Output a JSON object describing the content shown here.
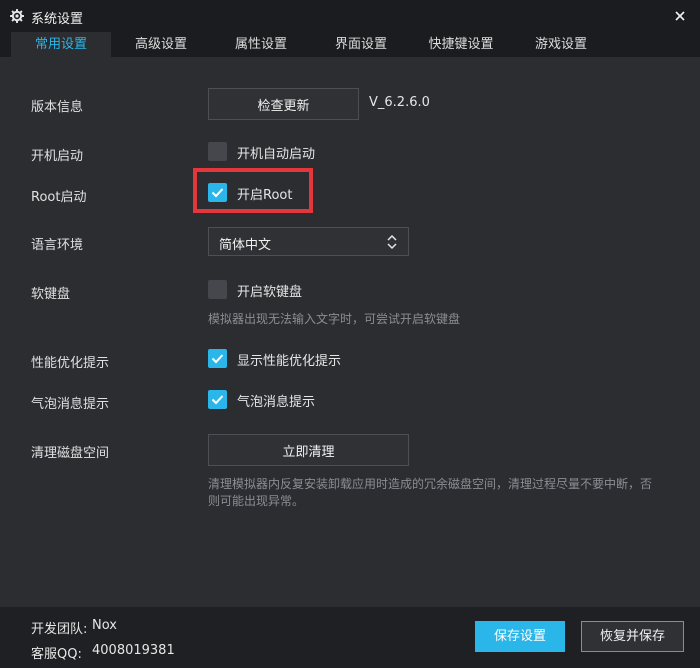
{
  "window": {
    "title": "系统设置",
    "icon": "gear-icon",
    "close_icon": "close-icon"
  },
  "tabs": [
    {
      "label": "常用设置",
      "active": true
    },
    {
      "label": "高级设置",
      "active": false
    },
    {
      "label": "属性设置",
      "active": false
    },
    {
      "label": "界面设置",
      "active": false
    },
    {
      "label": "快捷键设置",
      "active": false
    },
    {
      "label": "游戏设置",
      "active": false
    }
  ],
  "settings": {
    "version_info": {
      "label": "版本信息",
      "button": "检查更新",
      "version": "V_6.2.6.0"
    },
    "startup": {
      "label": "开机启动",
      "checkbox_label": "开机自动启动",
      "checked": false
    },
    "root": {
      "label": "Root启动",
      "checkbox_label": "开启Root",
      "checked": true
    },
    "language": {
      "label": "语言环境",
      "selected": "简体中文"
    },
    "soft_keyboard": {
      "label": "软键盘",
      "checkbox_label": "开启软键盘",
      "checked": false,
      "hint": "模拟器出现无法输入文字时，可尝试开启软键盘"
    },
    "performance_tip": {
      "label": "性能优化提示",
      "checkbox_label": "显示性能优化提示",
      "checked": true
    },
    "bubble_tip": {
      "label": "气泡消息提示",
      "checkbox_label": "气泡消息提示",
      "checked": true
    },
    "disk_cleanup": {
      "label": "清理磁盘空间",
      "button": "立即清理",
      "hint_line1": "清理模拟器内反复安装卸载应用时造成的冗余磁盘空间，清理过程尽量不要中断，否",
      "hint_line2": "则可能出现异常。"
    }
  },
  "footer": {
    "team_label": "开发团队:",
    "team_value": "Nox",
    "qq_label": "客服QQ:",
    "qq_value": "4008019381",
    "save_button": "保存设置",
    "restore_button": "恢复并保存"
  },
  "colors": {
    "accent": "#2ab6e8",
    "highlight_box": "#e3373b",
    "background": "#2b2d31"
  }
}
